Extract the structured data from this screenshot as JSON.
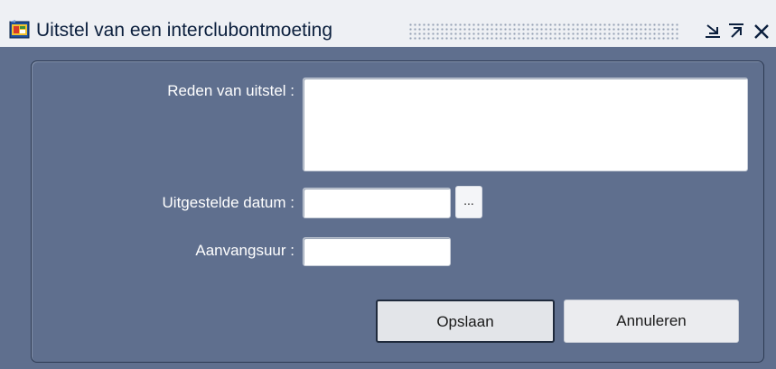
{
  "window": {
    "title": "Uitstel van een interclubontmoeting",
    "icons": {
      "app": "forms-app-icon",
      "minimize": "minimize-icon",
      "maximize": "maximize-icon",
      "close": "close-icon"
    }
  },
  "form": {
    "reason_label": "Reden van uitstel :",
    "reason_value": "",
    "postponed_date_label": "Uitgestelde datum :",
    "postponed_date_value": "",
    "date_picker_label": "...",
    "start_time_label": "Aanvangsuur :",
    "start_time_value": ""
  },
  "buttons": {
    "save_label": "Opslaan",
    "cancel_label": "Annuleren"
  },
  "colors": {
    "window_background": "#5f6f8e",
    "titlebar_background": "#eef0f4",
    "title_text": "#0b1f3d",
    "label_text": "#ffffff"
  }
}
